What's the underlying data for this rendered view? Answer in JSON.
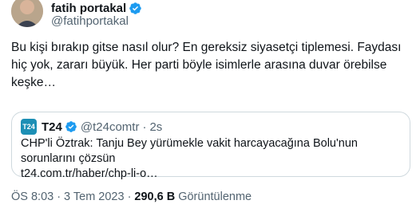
{
  "author": {
    "name": "fatih portakal",
    "handle": "@fatihportakal"
  },
  "tweet": {
    "text": "Bu kişi bırakıp gitse nasıl olur? En gereksiz siyasetçi tiplemesi. Faydası hiç yok, zararı büyük. Her parti böyle isimlerle arasına duvar örebilse keşke…"
  },
  "quote": {
    "logo_text": "T24",
    "name": "T24",
    "handle": "@t24comtr",
    "dot": "·",
    "time": "2s",
    "text": "CHP'li Öztrak: Tanju Bey yürümekle vakit harcayacağına Bolu'nun sorunlarını çözsün",
    "link": "t24.com.tr/haber/chp-li-o…"
  },
  "meta": {
    "time": "ÖS 8:03",
    "sep": "·",
    "date": "3 Tem 2023",
    "sep2": "·",
    "views": "290,6 B",
    "views_label": "Görüntülenme"
  },
  "colors": {
    "verified": "#1d9bf0",
    "t24_logo": "#1d8fb5",
    "muted": "#536471"
  }
}
